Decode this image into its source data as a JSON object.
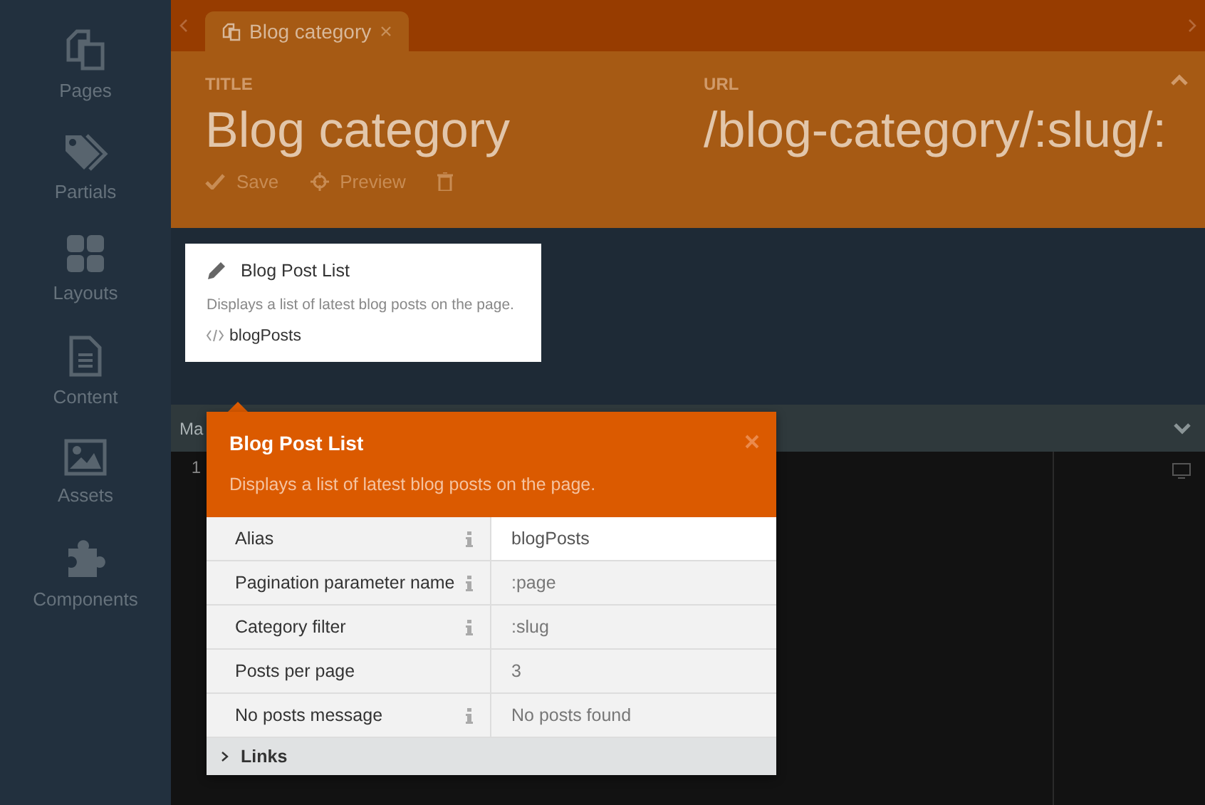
{
  "sidebar": {
    "items": [
      {
        "label": "Pages",
        "kind": "pages"
      },
      {
        "label": "Partials",
        "kind": "partials"
      },
      {
        "label": "Layouts",
        "kind": "layouts"
      },
      {
        "label": "Content",
        "kind": "content"
      },
      {
        "label": "Assets",
        "kind": "assets"
      },
      {
        "label": "Components",
        "kind": "components"
      }
    ]
  },
  "tabs": [
    {
      "label": "Blog category"
    }
  ],
  "header": {
    "title_label": "TITLE",
    "title": "Blog category",
    "url_label": "URL",
    "url": "/blog-category/:slug/:",
    "toolbar": [
      "Save",
      "Preview"
    ]
  },
  "component_card": {
    "title": "Blog Post List",
    "description": "Displays a list of latest blog posts on the page.",
    "alias": "blogPosts"
  },
  "editor": {
    "tab_label": "Ma",
    "line_numbers": [
      "1"
    ]
  },
  "popover": {
    "title": "Blog Post List",
    "description": "Displays a list of latest blog posts on the page.",
    "properties": [
      {
        "name": "Alias",
        "value": "blogPosts",
        "info": true,
        "selected": true
      },
      {
        "name": "Pagination parameter name",
        "value": ":page",
        "info": true,
        "selected": false
      },
      {
        "name": "Category filter",
        "value": ":slug",
        "info": true,
        "selected": false
      },
      {
        "name": "Posts per page",
        "value": "3",
        "info": false,
        "selected": false
      },
      {
        "name": "No posts message",
        "value": "No posts found",
        "info": true,
        "selected": false
      }
    ],
    "groups": [
      {
        "label": "Links",
        "expanded": false
      }
    ]
  }
}
